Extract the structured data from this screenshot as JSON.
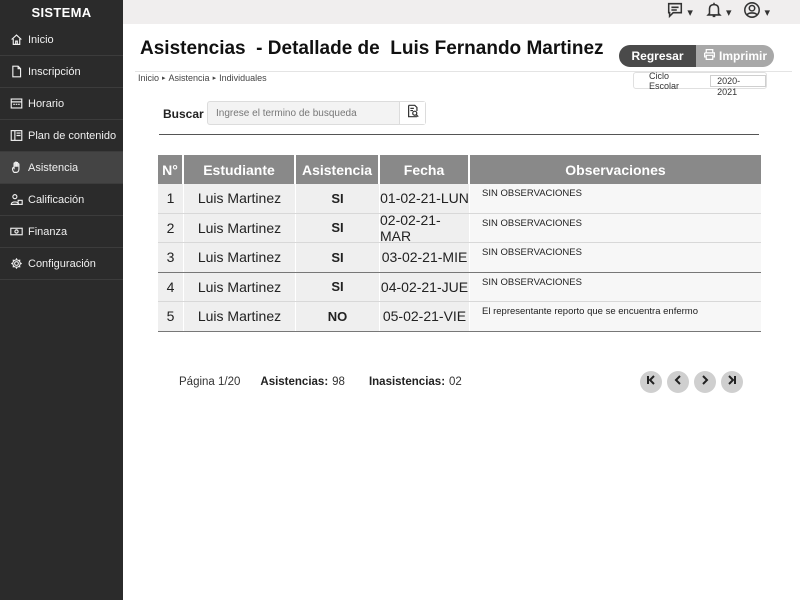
{
  "sidebar": {
    "brand": "SISTEMA",
    "items": [
      {
        "label": "Inicio",
        "icon": "home-icon"
      },
      {
        "label": "Inscripción",
        "icon": "document-icon"
      },
      {
        "label": "Horario",
        "icon": "calendar-icon"
      },
      {
        "label": "Plan de contenido",
        "icon": "book-icon"
      },
      {
        "label": "Asistencia",
        "icon": "hand-icon",
        "active": true
      },
      {
        "label": "Calificación",
        "icon": "user-grade-icon"
      },
      {
        "label": "Finanza",
        "icon": "money-icon"
      },
      {
        "label": "Configuración",
        "icon": "gear-icon"
      }
    ]
  },
  "topbar": {
    "icons": [
      "message-icon",
      "bell-icon",
      "user-icon"
    ],
    "caret": "▾"
  },
  "header": {
    "title": "Asistencias  - Detallade de  Luis Fernando Martinez",
    "regresar": "Regresar",
    "imprimir": "Imprimir"
  },
  "breadcrumb": {
    "items": [
      "Inicio",
      "Asistencia",
      "Individuales"
    ],
    "separator": "▸"
  },
  "ciclo": {
    "label": "Ciclo Escolar",
    "value": "2020-2021"
  },
  "search": {
    "label": "Buscar",
    "placeholder": "Ingrese el termino de busqueda"
  },
  "table": {
    "headers": [
      "N°",
      "Estudiante",
      "Asistencia",
      "Fecha",
      "Observaciones"
    ],
    "rows": [
      {
        "n": "1",
        "estudiante": "Luis Martinez",
        "asistencia": "SI",
        "fecha": "01-02-21-LUN",
        "observaciones": "SIN OBSERVACIONES"
      },
      {
        "n": "2",
        "estudiante": "Luis Martinez",
        "asistencia": "SI",
        "fecha": "02-02-21-MAR",
        "observaciones": "SIN OBSERVACIONES"
      },
      {
        "n": "3",
        "estudiante": "Luis Martinez",
        "asistencia": "SI",
        "fecha": "03-02-21-MIE",
        "observaciones": "SIN OBSERVACIONES"
      },
      {
        "n": "4",
        "estudiante": "Luis Martinez",
        "asistencia": "SI",
        "fecha": "04-02-21-JUE",
        "observaciones": "SIN OBSERVACIONES"
      },
      {
        "n": "5",
        "estudiante": "Luis Martinez",
        "asistencia": "NO",
        "fecha": "05-02-21-VIE",
        "observaciones": "El representante reporto que se  encuentra enfermo"
      }
    ]
  },
  "footer": {
    "pagina": "Página 1/20",
    "asistencias_label": "Asistencias:",
    "asistencias_value": "98",
    "inasistencias_label": "Inasistencias:",
    "inasistencias_value": "02"
  },
  "pager": {
    "buttons": [
      "first-page-icon",
      "prev-page-icon",
      "next-page-icon",
      "last-page-icon"
    ]
  }
}
